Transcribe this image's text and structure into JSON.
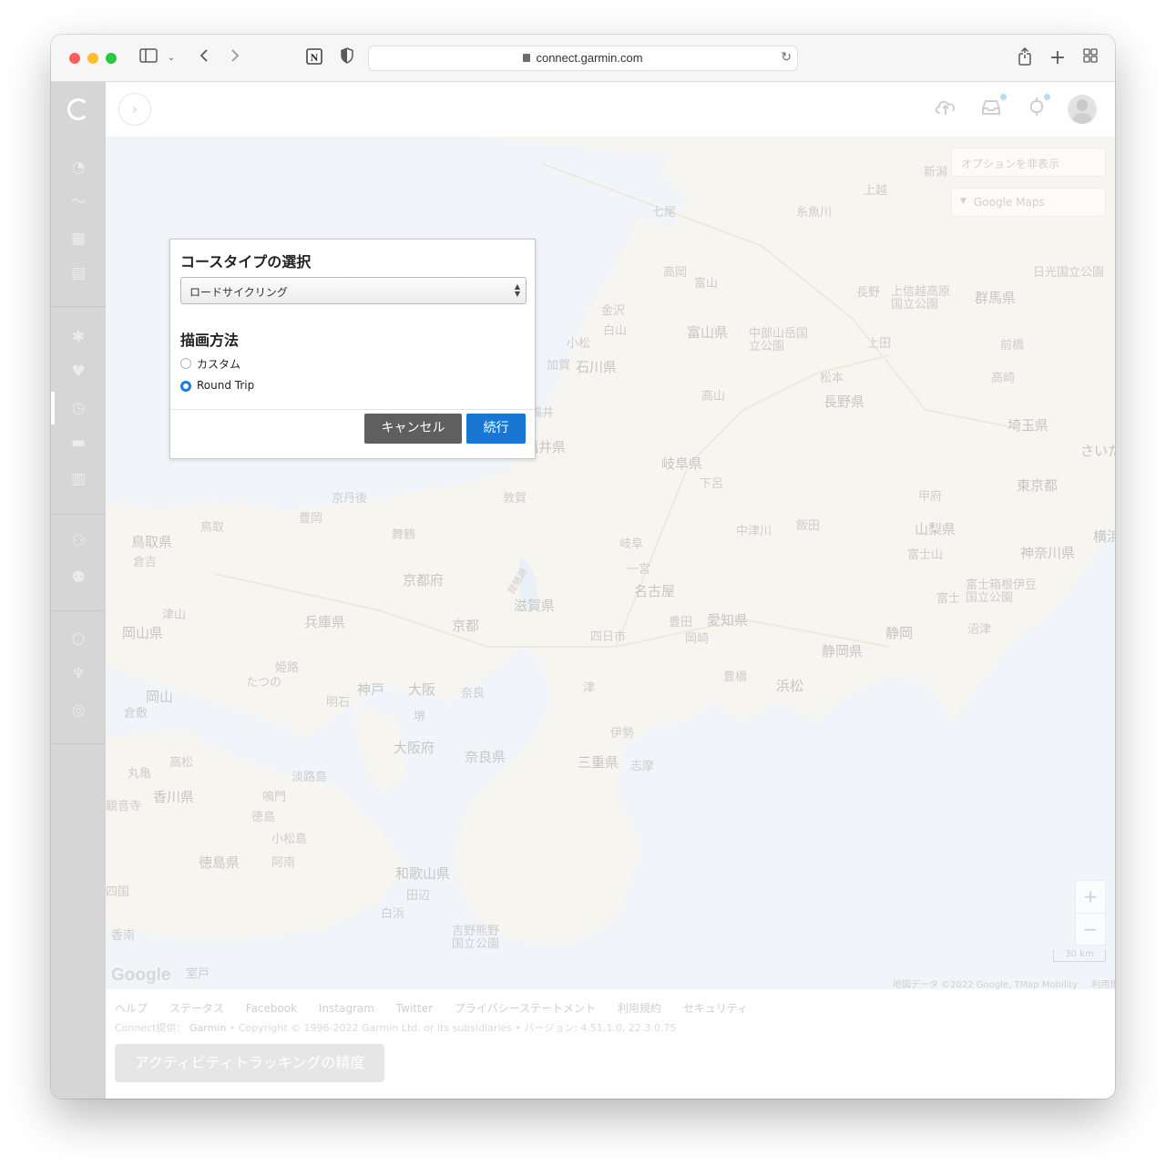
{
  "browser": {
    "url": "connect.garmin.com",
    "icons": [
      "sidebar-toggle-icon",
      "back-icon",
      "forward-icon",
      "notion-icon",
      "shield-icon",
      "share-icon",
      "new-tab-icon",
      "tab-overview-icon"
    ]
  },
  "map": {
    "options_toggle": "オプションを非表示",
    "map_type": "Google Maps",
    "zoom_in": "+",
    "zoom_out": "−",
    "scale": "30 km",
    "attribution": "地図データ ©2022 Google, TMap Mobility",
    "terms": "利用規約",
    "google_logo": "Google",
    "labels": {
      "niigata": "新潟",
      "kamiechigo": "上越",
      "itoigawa": "糸魚川",
      "nanao": "七尾",
      "takaoka": "高岡",
      "toyama": "富山",
      "toyama_pref": "富山県",
      "kanazawa": "金沢",
      "hakusan": "白山",
      "komatsu": "小松",
      "kaga": "加賀",
      "ishikawa_pref": "石川県",
      "fukui": "福井",
      "fukui_pref": "福井県",
      "nagano": "長野",
      "nagano_pref": "長野県",
      "ueda": "上田",
      "matsumoto": "松本",
      "takayama": "高山",
      "gifu_pref": "岐阜県",
      "gero": "下呂",
      "gunma_pref": "群馬県",
      "maebashi": "前橋",
      "takasaki": "高崎",
      "saitama_pref": "埼玉県",
      "tokyo_to": "東京都",
      "kofu": "甲府",
      "yamanashi_pref": "山梨県",
      "kanagawa_pref": "神奈川県",
      "fujisan": "富士山",
      "fuji": "富士",
      "numazu": "沼津",
      "shizuoka": "静岡",
      "shizuoka_pref": "静岡県",
      "hamamatsu": "浜松",
      "toyohashi": "豊橋",
      "nagoya": "名古屋",
      "aichi_pref": "愛知県",
      "toyota": "豊田",
      "okazaki": "岡崎",
      "gifu": "岐阜",
      "ichinomiya": "一宮",
      "nakatsugawa": "中津川",
      "iida": "飯田",
      "tsuruga": "敦賀",
      "shiga_pref": "滋賀県",
      "kyoto": "京都",
      "kyoto_pref": "京都府",
      "osaka": "大阪",
      "osaka_pref": "大阪府",
      "kobe": "神戸",
      "nara": "奈良",
      "nara_pref": "奈良県",
      "yokkaichi": "四日市",
      "tsu": "津",
      "ise": "伊勢",
      "mie_pref": "三重県",
      "shima": "志摩",
      "hyogo_pref": "兵庫県",
      "himeji": "姫路",
      "akashi": "明石",
      "okayama": "岡山",
      "okayama_pref": "岡山県",
      "kurashiki": "倉敷",
      "tottori": "鳥取",
      "tottori_pref": "鳥取県",
      "kurayoshi": "倉吉",
      "tsuyama": "津山",
      "maizuru": "舞鶴",
      "toyooka": "豊岡",
      "takamatsu": "高松",
      "kagawa_pref": "香川県",
      "tokushima": "徳島",
      "tokushima_pref": "徳島県",
      "naruto": "鳴門",
      "wakayama_pref": "和歌山県",
      "tanabe": "田辺",
      "shirahama": "白浜",
      "muroto": "室戸",
      "awaji": "淡路島",
      "sakai": "堺",
      "kyotango": "京丹後",
      "saitama": "さいた",
      "yokohama": "横浜",
      "hida_park": "中部山岳国立公園",
      "joshinetsu_park": "上信越高原国立公園",
      "nikko_park": "日光国立公園",
      "fuji_park": "富士箱根伊豆国立公園",
      "yoshino_park": "吉野熊野国立公園",
      "tatsuno": "たつの",
      "marugame": "丸亀",
      "anan": "阿南",
      "komatsushima": "小松島",
      "kanonji": "観音寺",
      "shikoku": "四国",
      "kochi": "香南",
      "biwako": "琵琶湖"
    }
  },
  "footer": {
    "links": [
      "ヘルプ",
      "ステータス",
      "Facebook",
      "Instagram",
      "Twitter",
      "プライバシーステートメント",
      "利用規約",
      "セキュリティ"
    ],
    "provided_by": "Connect提供：",
    "brand": "Garmin",
    "copyright": " • Copyright © 1996-2022 Garmin Ltd. or its subsidiaries • バージョン: 4.51.1.0, 22.3.0.75",
    "accuracy_button": "アクティビティトラッキングの精度"
  },
  "dialog": {
    "title": "コースタイプの選択",
    "course_type": "ロードサイクリング",
    "draw_method_title": "描画方法",
    "options": [
      {
        "label": "カスタム",
        "checked": false
      },
      {
        "label": "Round Trip",
        "checked": true
      }
    ],
    "cancel": "キャンセル",
    "continue": "続行"
  },
  "colors": {
    "primary_button": "#1777d2",
    "secondary_button": "#5f5f5f",
    "radio_selected": "#1a7ae8"
  }
}
